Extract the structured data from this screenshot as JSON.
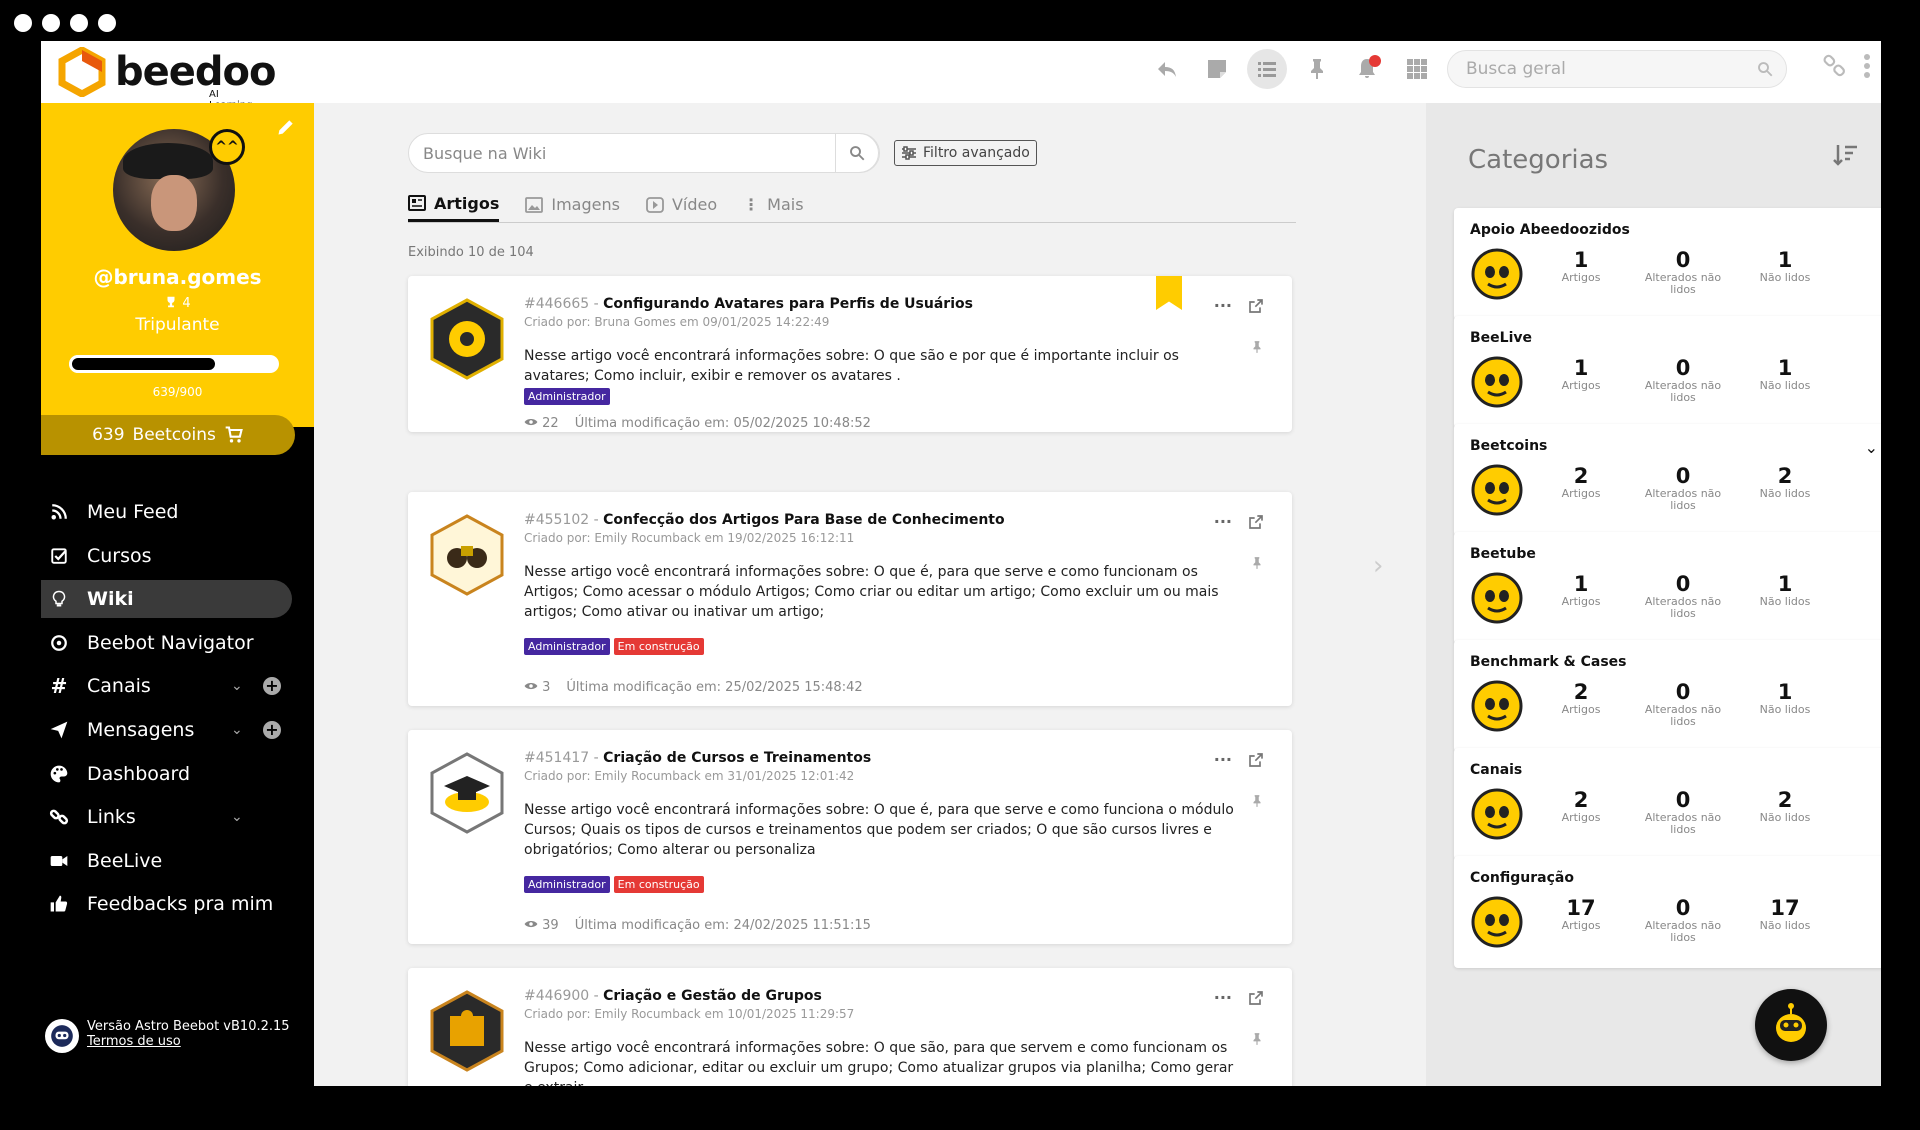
{
  "topbar": {
    "logo_text": "beedoo",
    "logo_sub": "AI Learning",
    "search_placeholder": "Busca geral"
  },
  "profile": {
    "username": "@bruna.gomes",
    "trophies": "4",
    "rank": "Tripulante",
    "progress_text": "639/900",
    "progress_fraction": 0.71,
    "beetcoins_value": "639",
    "beetcoins_label": "Beetcoins"
  },
  "nav": [
    {
      "label": "Meu Feed",
      "icon": "rss-icon"
    },
    {
      "label": "Cursos",
      "icon": "checkbox-icon"
    },
    {
      "label": "Wiki",
      "icon": "lightbulb-icon"
    },
    {
      "label": "Beebot Navigator",
      "icon": "compass-icon"
    },
    {
      "label": "Canais",
      "icon": "hash-icon"
    },
    {
      "label": "Mensagens",
      "icon": "paper-plane-icon"
    },
    {
      "label": "Dashboard",
      "icon": "palette-icon"
    },
    {
      "label": "Links",
      "icon": "link-icon"
    },
    {
      "label": "BeeLive",
      "icon": "video-icon"
    },
    {
      "label": "Feedbacks pra mim",
      "icon": "thumbs-up-icon"
    }
  ],
  "footer": {
    "version": "Versão Astro Beebot vB10.2.15",
    "terms": "Termos de uso"
  },
  "wiki": {
    "search_placeholder": "Busque na Wiki",
    "advanced_filter": "Filtro avançado",
    "tabs": [
      "Artigos",
      "Imagens",
      "Vídeo",
      "Mais"
    ],
    "showing": "Exibindo 10 de 104"
  },
  "articles": [
    {
      "id": "#446665",
      "title": "Configurando Avatares para Perfis de Usuários",
      "created": "Criado por: Bruna Gomes em 09/01/2025 14:22:49",
      "desc": "Nesse artigo você encontrará informações sobre: O que são e por que é importante incluir os avatares; Como incluir, exibir e remover os avatares .",
      "tags": [
        "Administrador"
      ],
      "views": "22",
      "modified": "Última modificação em: 05/02/2025 10:48:52"
    },
    {
      "id": "#455102",
      "title": "Confecção dos Artigos Para Base de Conhecimento",
      "created": "Criado por: Emily Rocumback em 19/02/2025 16:12:11",
      "desc": "Nesse artigo você encontrará informações sobre: O que é, para que serve e como funcionam os Artigos; Como acessar o módulo Artigos; Como criar ou editar um artigo; Como excluir um ou mais artigos; Como ativar ou inativar um artigo;",
      "tags": [
        "Administrador",
        "Em construção"
      ],
      "views": "3",
      "modified": "Última modificação em: 25/02/2025 15:48:42"
    },
    {
      "id": "#451417",
      "title": "Criação de Cursos e Treinamentos",
      "created": "Criado por: Emily Rocumback em 31/01/2025 12:01:42",
      "desc": "Nesse artigo você encontrará informações sobre: O que é, para que serve e como funciona o módulo Cursos; Quais os tipos de cursos e treinamentos que podem ser criados; O que são cursos livres e obrigatórios; Como alterar ou personaliza",
      "tags": [
        "Administrador",
        "Em construção"
      ],
      "views": "39",
      "modified": "Última modificação em: 24/02/2025 11:51:15"
    },
    {
      "id": "#446900",
      "title": "Criação e Gestão de Grupos",
      "created": "Criado por: Emily Rocumback em 10/01/2025 11:29:57",
      "desc": "Nesse artigo você encontrará informações sobre: O que são, para que servem e como funcionam os Grupos; Como adicionar, editar ou excluir um grupo; Como atualizar grupos via planilha; Como gerar e extrair",
      "tags": [],
      "views": "",
      "modified": ""
    }
  ],
  "categories": {
    "title": "Categorias",
    "labels": {
      "artigos": "Artigos",
      "alterados": "Alterados não lidos",
      "nao_lidos": "Não lidos"
    },
    "items": [
      {
        "name": "Apoio Abeedoozidos",
        "artigos": "1",
        "alterados": "0",
        "nao_lidos": "1"
      },
      {
        "name": "BeeLive",
        "artigos": "1",
        "alterados": "0",
        "nao_lidos": "1"
      },
      {
        "name": "Beetcoins",
        "artigos": "2",
        "alterados": "0",
        "nao_lidos": "2"
      },
      {
        "name": "Beetube",
        "artigos": "1",
        "alterados": "0",
        "nao_lidos": "1"
      },
      {
        "name": "Benchmark & Cases",
        "artigos": "2",
        "alterados": "0",
        "nao_lidos": "1"
      },
      {
        "name": "Canais",
        "artigos": "2",
        "alterados": "0",
        "nao_lidos": "2"
      },
      {
        "name": "Configuração",
        "artigos": "17",
        "alterados": "0",
        "nao_lidos": "17"
      }
    ]
  },
  "colors": {
    "brand_yellow": "#ffcc00",
    "admin_tag": "#4527a0",
    "construction_tag": "#e53935"
  }
}
